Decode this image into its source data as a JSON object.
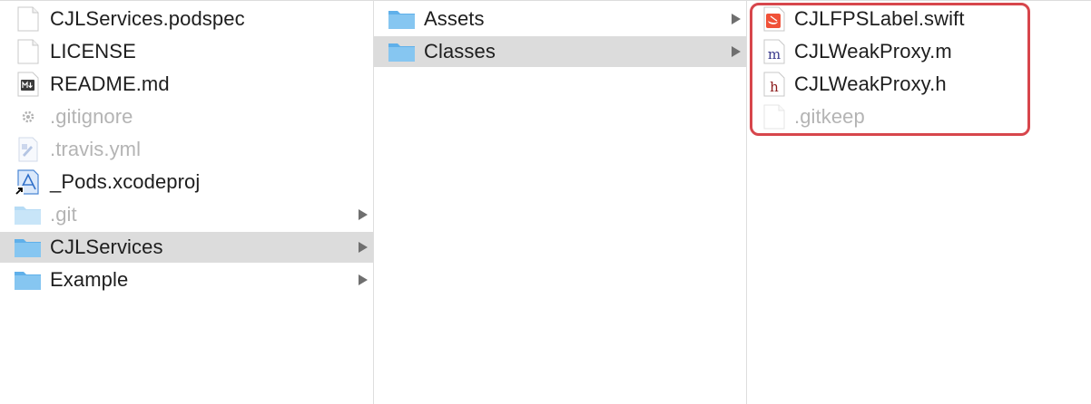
{
  "columns": [
    {
      "items": [
        {
          "label": "CJLServices.podspec",
          "icon": "document-icon",
          "dim": false,
          "selected": false,
          "folder": false
        },
        {
          "label": "LICENSE",
          "icon": "document-icon",
          "dim": false,
          "selected": false,
          "folder": false
        },
        {
          "label": "README.md",
          "icon": "markdown-file-icon",
          "dim": false,
          "selected": false,
          "folder": false
        },
        {
          "label": ".gitignore",
          "icon": "gear-file-icon",
          "dim": true,
          "selected": false,
          "folder": false
        },
        {
          "label": ".travis.yml",
          "icon": "yaml-file-icon",
          "dim": true,
          "selected": false,
          "folder": false
        },
        {
          "label": "_Pods.xcodeproj",
          "icon": "xcode-project-alias-icon",
          "dim": false,
          "selected": false,
          "folder": false
        },
        {
          "label": ".git",
          "icon": "folder-icon",
          "dim": true,
          "selected": false,
          "folder": true
        },
        {
          "label": "CJLServices",
          "icon": "folder-icon",
          "dim": false,
          "selected": true,
          "folder": true
        },
        {
          "label": "Example",
          "icon": "folder-icon",
          "dim": false,
          "selected": false,
          "folder": true
        }
      ]
    },
    {
      "items": [
        {
          "label": "Assets",
          "icon": "folder-icon",
          "dim": false,
          "selected": false,
          "folder": true
        },
        {
          "label": "Classes",
          "icon": "folder-icon",
          "dim": false,
          "selected": true,
          "folder": true
        }
      ]
    },
    {
      "items": [
        {
          "label": "CJLFPSLabel.swift",
          "icon": "swift-file-icon",
          "dim": false,
          "selected": false,
          "folder": false
        },
        {
          "label": "CJLWeakProxy.m",
          "icon": "objc-implementation-file-icon",
          "glyph": "m",
          "dim": false,
          "selected": false,
          "folder": false
        },
        {
          "label": "CJLWeakProxy.h",
          "icon": "header-file-icon",
          "glyph": "h",
          "dim": false,
          "selected": false,
          "folder": false
        },
        {
          "label": ".gitkeep",
          "icon": "document-icon",
          "dim": true,
          "selected": false,
          "folder": false
        }
      ]
    }
  ],
  "colors": {
    "selection": "#dcdcdc",
    "highlight_border": "#d7464c",
    "folder": "#7cc0ee",
    "swift": "#f05138",
    "objc_m": "#3a3a8c",
    "header_h": "#8b1a1a"
  }
}
